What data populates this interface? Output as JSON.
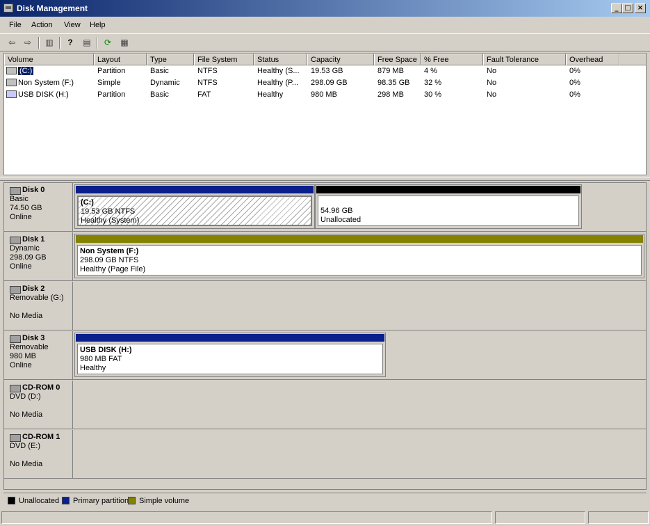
{
  "window": {
    "title": "Disk Management",
    "controls": {
      "minimize": "_",
      "maximize": "□",
      "close": "×"
    }
  },
  "menu": [
    "File",
    "Action",
    "View",
    "Help"
  ],
  "toolbar": {
    "icons": [
      "back-arrow-icon",
      "forward-arrow-icon",
      "show-hide-tree-icon",
      "help-icon",
      "properties-icon",
      "refresh-icon",
      "export-list-icon"
    ],
    "glyphs": {
      "back": "⇦",
      "forward": "⇨",
      "tree": "▥",
      "help": "?",
      "props": "▤",
      "refresh": "⟳",
      "export": "▦"
    }
  },
  "volume_list": {
    "columns": [
      "Volume",
      "Layout",
      "Type",
      "File System",
      "Status",
      "Capacity",
      "Free Space",
      "% Free",
      "Fault Tolerance",
      "Overhead"
    ],
    "rows": [
      [
        "(C:)",
        "Partition",
        "Basic",
        "NTFS",
        "Healthy (S...",
        "19.53 GB",
        "879 MB",
        "4 %",
        "No",
        "0%"
      ],
      [
        "Non System (F:)",
        "Simple",
        "Dynamic",
        "NTFS",
        "Healthy (P...",
        "298.09 GB",
        "98.35 GB",
        "32 %",
        "No",
        "0%"
      ],
      [
        "USB DISK (H:)",
        "Partition",
        "Basic",
        "FAT",
        "Healthy",
        "980 MB",
        "298 MB",
        "30 %",
        "No",
        "0%"
      ]
    ]
  },
  "disks": [
    {
      "name": "Disk 0",
      "lines": [
        "Basic",
        "74.50 GB",
        "Online"
      ],
      "partitions": [
        {
          "title": "(C:)",
          "size": "19.53 GB NTFS",
          "status": "Healthy (System)"
        },
        {
          "title": "",
          "size": "54.96 GB",
          "status": "Unallocated"
        }
      ]
    },
    {
      "name": "Disk 1",
      "lines": [
        "Dynamic",
        "298.09 GB",
        "Online"
      ],
      "partitions": [
        {
          "title": "Non System  (F:)",
          "size": "298.09 GB NTFS",
          "status": "Healthy (Page File)"
        }
      ]
    },
    {
      "name": "Disk 2",
      "lines": [
        "Removable (G:)",
        "",
        "No Media"
      ],
      "partitions": []
    },
    {
      "name": "Disk 3",
      "lines": [
        "Removable",
        "980 MB",
        "Online"
      ],
      "partitions": [
        {
          "title": "USB DISK  (H:)",
          "size": "980 MB FAT",
          "status": "Healthy"
        }
      ]
    },
    {
      "name": "CD-ROM 0",
      "lines": [
        "DVD (D:)",
        "",
        "No Media"
      ],
      "partitions": []
    },
    {
      "name": "CD-ROM 1",
      "lines": [
        "DVD (E:)",
        "",
        "No Media"
      ],
      "partitions": []
    }
  ],
  "legend": [
    {
      "label": "Unallocated",
      "color": "#000000"
    },
    {
      "label": "Primary partition",
      "color": "#0a1e8c"
    },
    {
      "label": "Simple volume",
      "color": "#848200"
    }
  ],
  "colors": {
    "primary": "#0a1e8c",
    "unallocated": "#000000",
    "simple": "#848200"
  }
}
